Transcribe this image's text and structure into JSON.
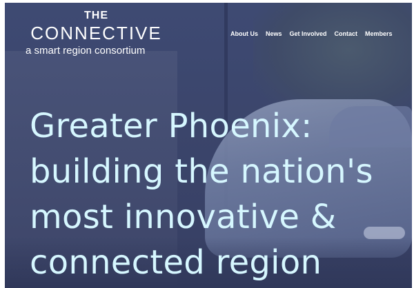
{
  "logo": {
    "the": "THE",
    "name": "CONNECTIVE",
    "tagline": "a smart region consortium"
  },
  "nav": {
    "items": [
      "About Us",
      "News",
      "Get Involved",
      "Contact",
      "Members"
    ]
  },
  "hero": {
    "headline_lines": [
      "Greater Phoenix:",
      "building the nation's",
      "most innovative &",
      "connected region"
    ]
  },
  "colors": {
    "overlay": "#3a4368",
    "headline": "#d6f7ff",
    "nav_text": "#ffffff"
  }
}
